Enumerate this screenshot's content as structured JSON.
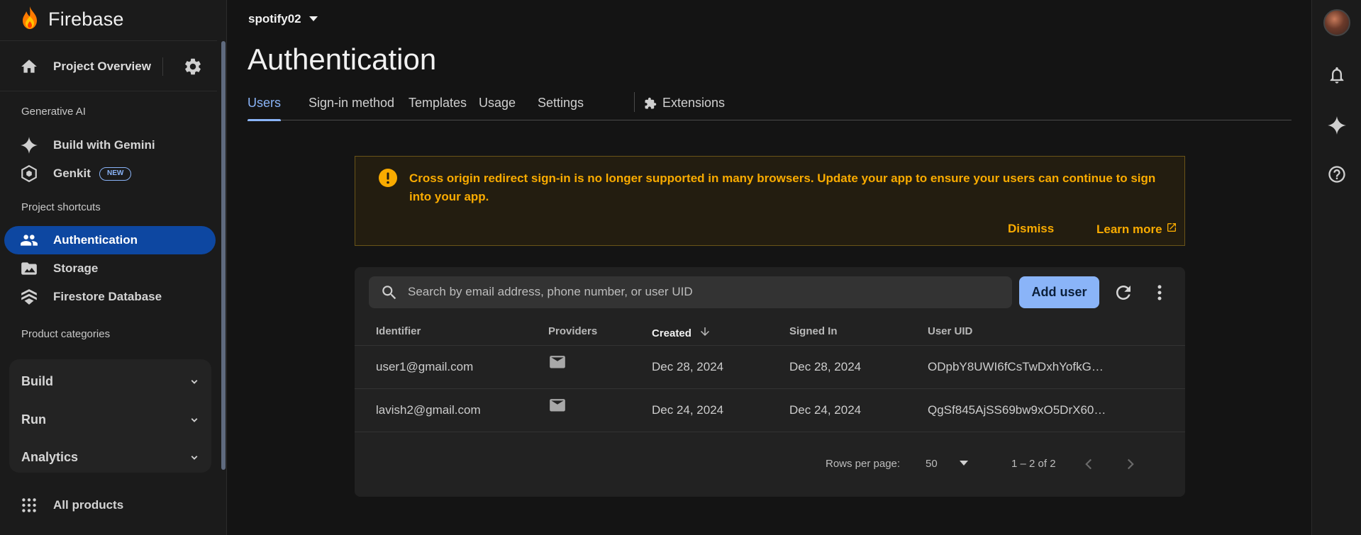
{
  "sidebar": {
    "brand": "Firebase",
    "overview_label": "Project Overview",
    "section_genai": "Generative AI",
    "build_with_gemini": "Build with Gemini",
    "genkit": "Genkit",
    "genkit_badge": "NEW",
    "section_shortcuts": "Project shortcuts",
    "authentication": "Authentication",
    "storage": "Storage",
    "firestore": "Firestore Database",
    "section_categories": "Product categories",
    "categories": [
      "Build",
      "Run",
      "Analytics"
    ],
    "all_products": "All products"
  },
  "header": {
    "project": "spotify02",
    "title": "Authentication"
  },
  "tabs": [
    "Users",
    "Sign-in method",
    "Templates",
    "Usage",
    "Settings",
    "Extensions"
  ],
  "banner": {
    "message": "Cross origin redirect sign-in is no longer supported in many browsers. Update your app to ensure your users can continue to sign into your app.",
    "dismiss": "Dismiss",
    "learn_more": "Learn more"
  },
  "users": {
    "search_placeholder": "Search by email address, phone number, or user UID",
    "add_user": "Add user",
    "columns": [
      "Identifier",
      "Providers",
      "Created",
      "Signed In",
      "User UID"
    ],
    "rows": [
      {
        "identifier": "user1@gmail.com",
        "provider": "mail-icon",
        "created": "Dec 28, 2024",
        "signed_in": "Dec 28, 2024",
        "uid": "ODpbY8UWI6fCsTwDxhYofkG…"
      },
      {
        "identifier": "lavish2@gmail.com",
        "provider": "mail-icon",
        "created": "Dec 24, 2024",
        "signed_in": "Dec 24, 2024",
        "uid": "QgSf845AjSS69bw9xO5DrX60…"
      }
    ],
    "rows_per_page_label": "Rows per page:",
    "rows_per_page": "50",
    "range": "1 – 2 of 2"
  },
  "colors": {
    "accent": "#8ab4f8",
    "active_nav": "#0d47a1",
    "warning": "#f9ab00",
    "background": "#141414"
  }
}
